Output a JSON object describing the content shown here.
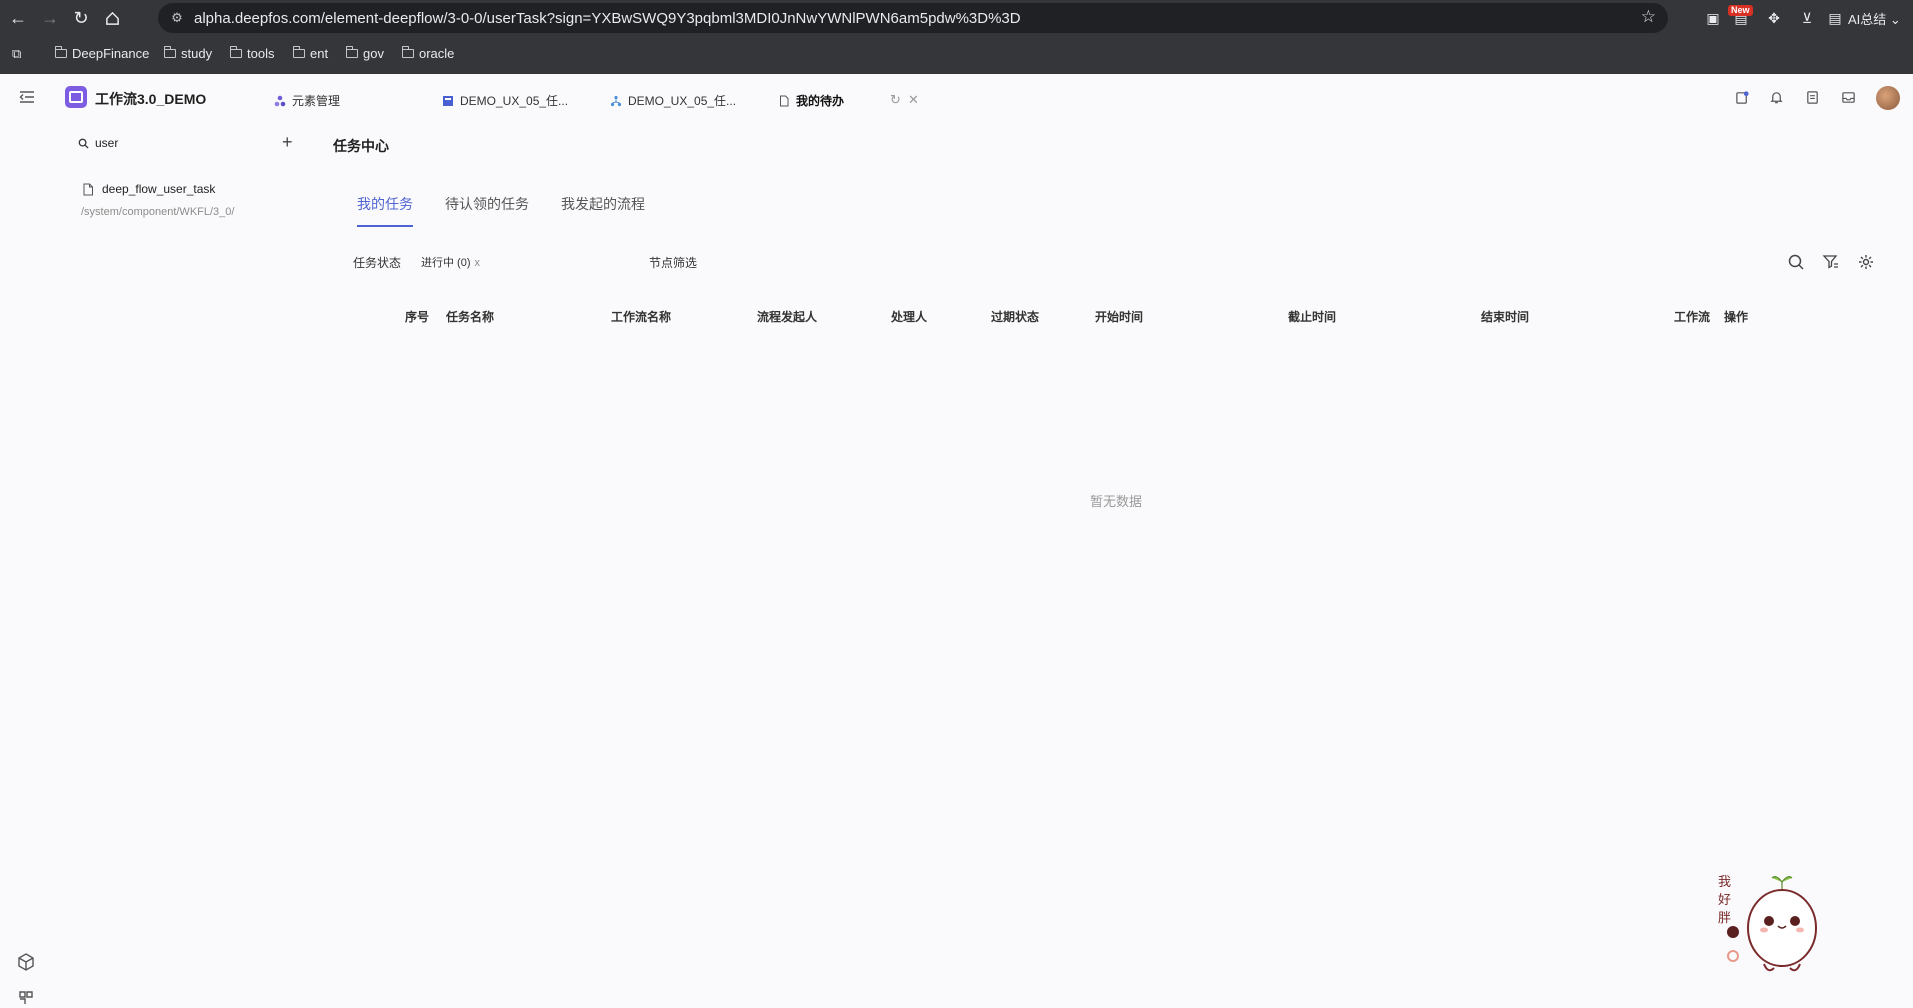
{
  "browser": {
    "url": "alpha.deepfos.com/element-deepflow/3-0-0/userTask?sign=YXBwSWQ9Y3pqbml3MDI0JnNwYWNlPWN6am5pdw%3D%3D",
    "new_badge": "New",
    "ai_summary": "AI总结",
    "bookmarks": [
      "DeepFinance",
      "study",
      "tools",
      "ent",
      "gov",
      "oracle"
    ]
  },
  "app": {
    "name": "工作流3.0_DEMO",
    "tabs": [
      "元素管理",
      "DEMO_UX_05_任...",
      "DEMO_UX_05_任...",
      "我的待办"
    ],
    "accent": "#4f63d2"
  },
  "sidebar": {
    "search_value": "user",
    "tree_item": "deep_flow_user_task",
    "tree_path": "/system/component/WKFL/3_0/"
  },
  "main": {
    "title": "任务中心",
    "subtabs": [
      "我的任务",
      "待认领的任务",
      "我发起的流程"
    ],
    "filter_status_label": "任务状态",
    "filter_status_value": "进行中 (0)",
    "filter_status_clear": "x",
    "filter_node_label": "节点筛选",
    "columns": [
      "序号",
      "任务名称",
      "工作流名称",
      "流程发起人",
      "处理人",
      "过期状态",
      "开始时间",
      "截止时间",
      "结束时间",
      "工作流",
      "操作"
    ],
    "empty_text": "暂无数据"
  },
  "mascot": {
    "text": "我好胖"
  }
}
